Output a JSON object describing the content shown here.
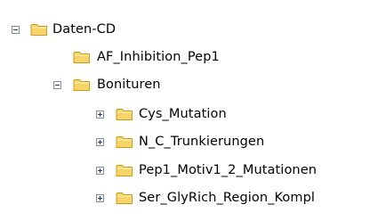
{
  "tree": {
    "nodes": [
      {
        "label": "Daten-CD",
        "expanded": true,
        "has_children": true,
        "depth": 0,
        "icon": "folder-icon"
      },
      {
        "label": "AF_Inhibition_Pep1",
        "expanded": false,
        "has_children": false,
        "depth": 1,
        "icon": "folder-icon"
      },
      {
        "label": "Bonituren",
        "expanded": true,
        "has_children": true,
        "depth": 1,
        "icon": "folder-icon"
      },
      {
        "label": "Cys_Mutation",
        "expanded": false,
        "has_children": true,
        "depth": 2,
        "icon": "folder-icon"
      },
      {
        "label": "N_C_Trunkierungen",
        "expanded": false,
        "has_children": true,
        "depth": 2,
        "icon": "folder-icon"
      },
      {
        "label": "Pep1_Motiv1_2_Mutationen",
        "expanded": false,
        "has_children": true,
        "depth": 2,
        "icon": "folder-icon"
      },
      {
        "label": "Ser_GlyRich_Region_Kompl",
        "expanded": false,
        "has_children": true,
        "depth": 2,
        "icon": "folder-icon"
      }
    ]
  },
  "colors": {
    "folder_fill": "#f7d56b",
    "folder_dark": "#c99a1b",
    "toggle_border": "#8b8b8b",
    "toggle_sign": "#1f3d7a"
  }
}
